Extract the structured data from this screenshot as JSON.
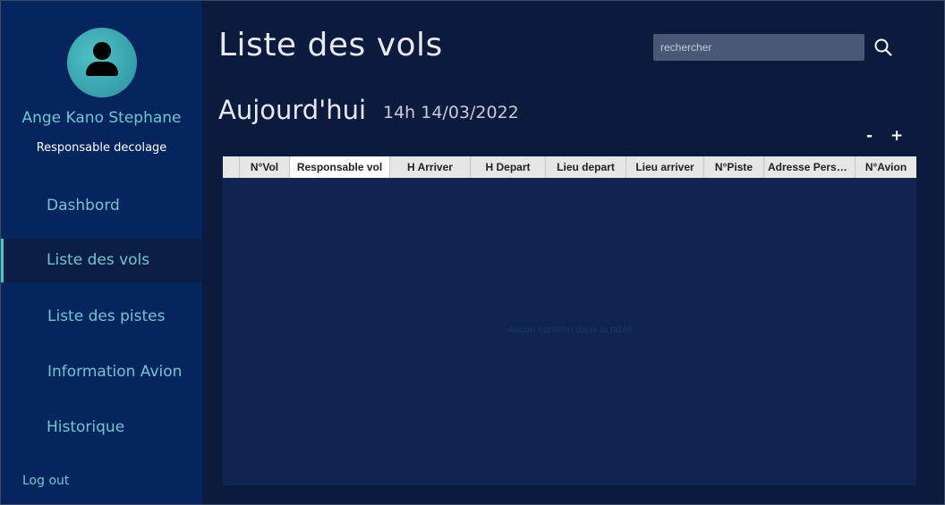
{
  "sidebar": {
    "user_name": "Ange Kano Stephane",
    "user_role": "Responsable decolage",
    "items": [
      {
        "label": "Dashbord"
      },
      {
        "label": "Liste des vols"
      },
      {
        "label": "Liste des pistes"
      },
      {
        "label": "Information Avion"
      },
      {
        "label": "Historique"
      }
    ],
    "logout_label": "Log out"
  },
  "header": {
    "title": "Liste des vols",
    "search_placeholder": "rechercher"
  },
  "today": {
    "label": "Aujourd'hui",
    "datetime": "14h 14/03/2022"
  },
  "zoom": {
    "minus": "-",
    "plus": "+"
  },
  "table": {
    "columns": [
      "N°Vol",
      "Responsable vol",
      "H Arriver",
      "H Depart",
      "Lieu depart",
      "Lieu arriver",
      "N°Piste",
      "Adresse Perso...",
      "N°Avion"
    ],
    "empty_message": "Aucun contenu dans la table",
    "rows": []
  },
  "colors": {
    "sidebar_bg": "#06245e",
    "main_bg": "#0b1a3d",
    "accent": "#6cc8cf",
    "table_bg": "#0f2450"
  }
}
